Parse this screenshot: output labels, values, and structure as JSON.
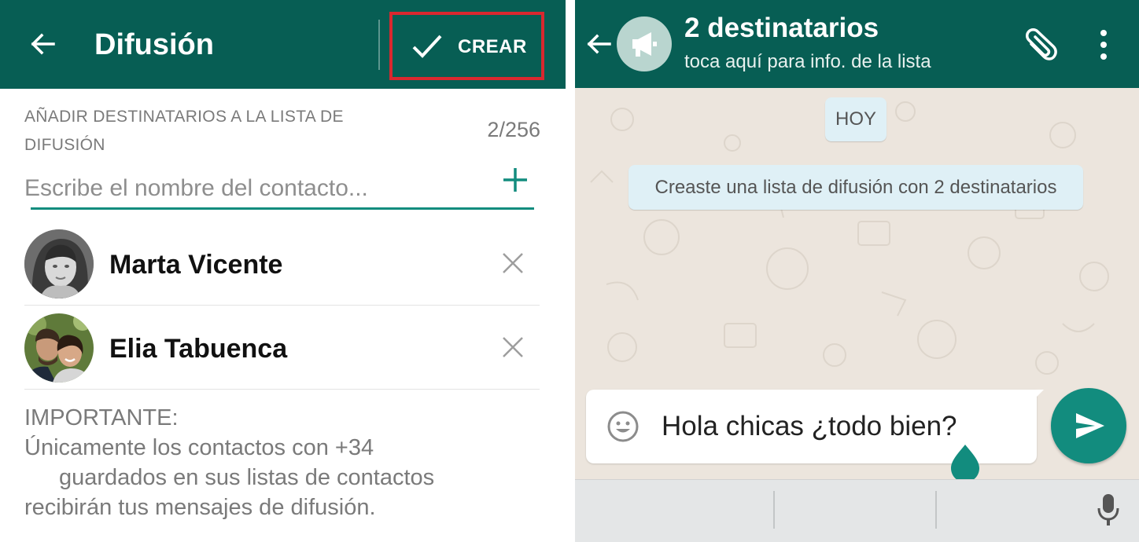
{
  "left_panel": {
    "header": {
      "title": "Difusión",
      "create_label": "CREAR"
    },
    "recipients": {
      "section_label": "AÑADIR DESTINATARIOS A LA LISTA DE DIFUSIÓN",
      "counter": "2/256",
      "search_placeholder": "Escribe el nombre del contacto..."
    },
    "contacts": [
      {
        "name": "Marta Vicente"
      },
      {
        "name": "Elia Tabuenca"
      }
    ],
    "notice": {
      "title": "IMPORTANTE:",
      "line1": "Únicamente los contactos con +34",
      "line2": "guardados en sus listas de contactos",
      "line3": "recibirán tus mensajes de difusión."
    }
  },
  "right_panel": {
    "header": {
      "title": "2 destinatarios",
      "subtitle": "toca aquí para info. de la lista"
    },
    "date_chip": "HOY",
    "system_message": "Creaste una lista de difusión con 2 destinatarios",
    "composer": {
      "value": "Hola chicas ¿todo bien?"
    }
  },
  "colors": {
    "appbar": "#075e54",
    "accent": "#128c7e",
    "highlight_border": "#d9282f",
    "chat_background": "#ece5dd"
  },
  "icons": [
    "back-arrow-icon",
    "check-icon",
    "plus-icon",
    "close-icon",
    "megaphone-icon",
    "paperclip-icon",
    "more-vert-icon",
    "emoji-icon",
    "send-icon",
    "mic-icon"
  ]
}
